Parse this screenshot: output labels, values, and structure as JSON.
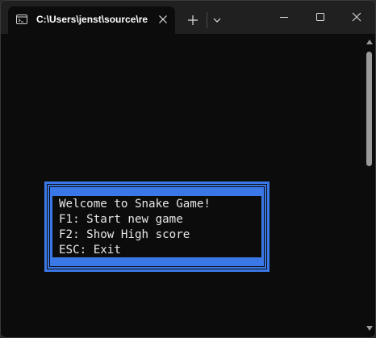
{
  "window": {
    "tab_title": "C:\\Users\\jenst\\source\\re",
    "tab_icon": "terminal-icon",
    "controls": [
      "minimize-icon",
      "maximize-icon",
      "close-icon"
    ]
  },
  "console": {
    "menu": {
      "lines": [
        "Welcome to Snake Game!",
        "F1: Start new game",
        "F2: Show High score",
        "ESC: Exit"
      ]
    }
  },
  "colors": {
    "console_bg": "#0c0c0c",
    "titlebar_bg": "#202020",
    "menu_frame": "#3b78e7",
    "text": "#e8e8e8"
  }
}
